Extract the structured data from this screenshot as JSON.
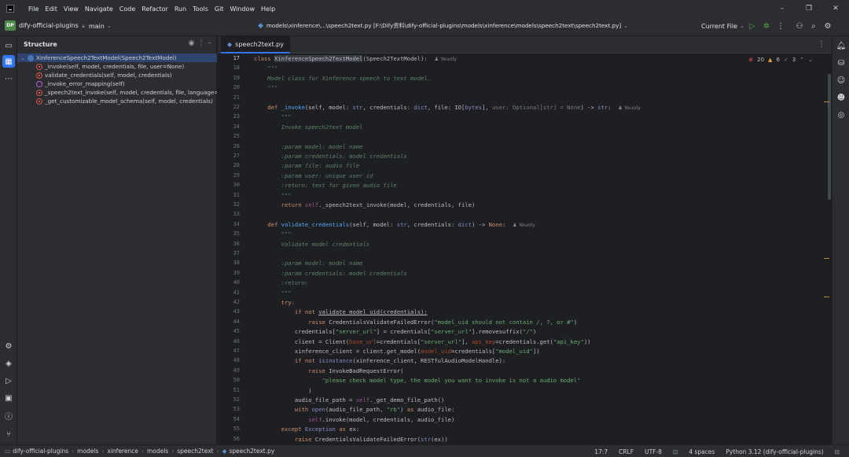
{
  "menu": {
    "items": [
      "File",
      "Edit",
      "View",
      "Navigate",
      "Code",
      "Refactor",
      "Run",
      "Tools",
      "Git",
      "Window",
      "Help"
    ]
  },
  "window": {
    "minimize": "–",
    "restore": "❐",
    "close": "✕"
  },
  "toolbar": {
    "project_badge": "DP",
    "project_name": "dify-official-plugins",
    "branch": "main",
    "path": "models\\xinference\\...\\speech2text.py [F:\\Dify资料\\dify-official-plugins\\models\\xinference\\models\\speech2text\\speech2text.py]",
    "run_config": "Current File"
  },
  "structure": {
    "title": "Structure",
    "nodes": [
      {
        "label": "XinferenceSpeech2TextModel(Speech2TextModel)",
        "icon": "class-icon"
      },
      {
        "label": "_invoke(self, model, credentials, file, user=None)",
        "icon": "method-icon"
      },
      {
        "label": "validate_credentials(self, model, credentials)",
        "icon": "method-icon"
      },
      {
        "label": "_invoke_error_mapping(self)",
        "icon": "property-icon"
      },
      {
        "label": "_speech2text_invoke(self, model, credentials, file, language=None, p",
        "icon": "method-icon"
      },
      {
        "label": "_get_customizable_model_schema(self, model, credentials)",
        "icon": "method-icon"
      }
    ]
  },
  "editor": {
    "tab": "speech2text.py",
    "inspections": {
      "errors": "20",
      "warnings": "6",
      "weak": "3"
    },
    "line_numbers": [
      "17",
      "18",
      "19",
      "20",
      "21",
      "22",
      "23",
      "24",
      "25",
      "26",
      "27",
      "28",
      "29",
      "30",
      "31",
      "32",
      "33",
      "34",
      "35",
      "36",
      "37",
      "38",
      "39",
      "40",
      "41",
      "42",
      "43",
      "44",
      "45",
      "46",
      "47",
      "48",
      "49",
      "50",
      "51",
      "52",
      "53",
      "54",
      "55",
      "56"
    ],
    "author": "Yeuoly",
    "code": {
      "l17_kw": "class ",
      "l17_name": "XinferenceSpeech2TextModel",
      "l17_rest": "(Speech2TextModel):",
      "l18": "    \"\"\"",
      "l19": "    Model class for Xinference speech to text model.",
      "l20": "    \"\"\"",
      "l22_def": "    def ",
      "l22_name": "_invoke",
      "l22_a": "(self, model: ",
      "l22_b": "str",
      "l22_c": ", credentials: ",
      "l22_d": "dict",
      "l22_e": ", file: IO[",
      "l22_f": "bytes",
      "l22_g": "], ",
      "l22_h": "user: Optional[str] = None",
      "l22_i": ") -> ",
      "l22_j": "str",
      "l22_k": ":",
      "l23": "        \"\"\"",
      "l24": "        Invoke speech2text model",
      "l26": "        :param model: model name",
      "l27": "        :param credentials: model credentials",
      "l28": "        :param file: audio file",
      "l29": "        :param user: unique user id",
      "l30": "        :return: text for given audio file",
      "l31": "        \"\"\"",
      "l32_kw": "        return ",
      "l32_self": "self",
      "l32_rest": "._speech2text_invoke(model, credentials, file)",
      "l34_def": "    def ",
      "l34_name": "validate_credentials",
      "l34_a": "(self, model: ",
      "l34_b": "str",
      "l34_c": ", credentials: ",
      "l34_d": "dict",
      "l34_e": ") -> ",
      "l34_f": "None",
      "l34_g": ":",
      "l35": "        \"\"\"",
      "l36": "        Validate model credentials",
      "l38": "        :param model: model name",
      "l39": "        :param credentials: model credentials",
      "l40": "        :return:",
      "l41": "        \"\"\"",
      "l42": "        try:",
      "l43_kw": "            if not ",
      "l43_rest": "validate_model_uid(credentials):",
      "l44_kw": "                raise ",
      "l44_a": "CredentialsValidateFailedError(",
      "l44_s": "\"model_uid should not contain /, ?, or #\"",
      "l44_e": ")",
      "l45_a": "            credentials[",
      "l45_s1": "\"server_url\"",
      "l45_b": "] = credentials[",
      "l45_s2": "\"server_url\"",
      "l45_c": "].removesuffix(",
      "l45_s3": "\"/\"",
      "l45_d": ")",
      "l46_a": "            client = Client(",
      "l46_p1": "base_url",
      "l46_b": "=credentials[",
      "l46_s1": "\"server_url\"",
      "l46_c": "], ",
      "l46_p2": "api_key",
      "l46_d": "=credentials.get(",
      "l46_s2": "\"api_key\"",
      "l46_e": "))",
      "l47_a": "            xinference_client = client.get_model(",
      "l47_p": "model_uid",
      "l47_b": "=credentials[",
      "l47_s": "\"model_uid\"",
      "l47_c": "])",
      "l48_kw": "            if not ",
      "l48_bi": "isinstance",
      "l48_rest": "(xinference_client, RESTfulAudioModelHandle):",
      "l49_kw": "                raise ",
      "l49_rest": "InvokeBadRequestError(",
      "l50": "                    \"please check model type, the model you want to invoke is not a audio model\"",
      "l51": "                )",
      "l52_a": "            audio_file_path = ",
      "l52_self": "self",
      "l52_b": "._get_demo_file_path()",
      "l53_kw": "            with ",
      "l53_bi": "open",
      "l53_a": "(audio_file_path, ",
      "l53_s": "\"rb\"",
      "l53_b": ") ",
      "l53_as": "as ",
      "l53_c": "audio_file:",
      "l54_self": "                self",
      "l54_rest": ".invoke(model, credentials, audio_file)",
      "l55_kw": "        except ",
      "l55_bi": "Exception ",
      "l55_as": "as ",
      "l55_rest": "ex:",
      "l56_kw": "            raise ",
      "l56_a": "CredentialsValidateFailedError(",
      "l56_bi": "str",
      "l56_b": "(ex))"
    }
  },
  "statusbar": {
    "crumbs": [
      "dify-official-plugins",
      "models",
      "xinference",
      "models",
      "speech2text",
      "speech2text.py"
    ],
    "position": "17:7",
    "line_sep": "CRLF",
    "encoding": "UTF-8",
    "indent": "4 spaces",
    "interpreter": "Python 3.12 (dify-official-plugins)"
  },
  "colors": {
    "accent": "#3574f0",
    "keyword": "#cf8e6d",
    "function": "#56a8f5",
    "string": "#6aab73",
    "docstring": "#5f826b"
  }
}
